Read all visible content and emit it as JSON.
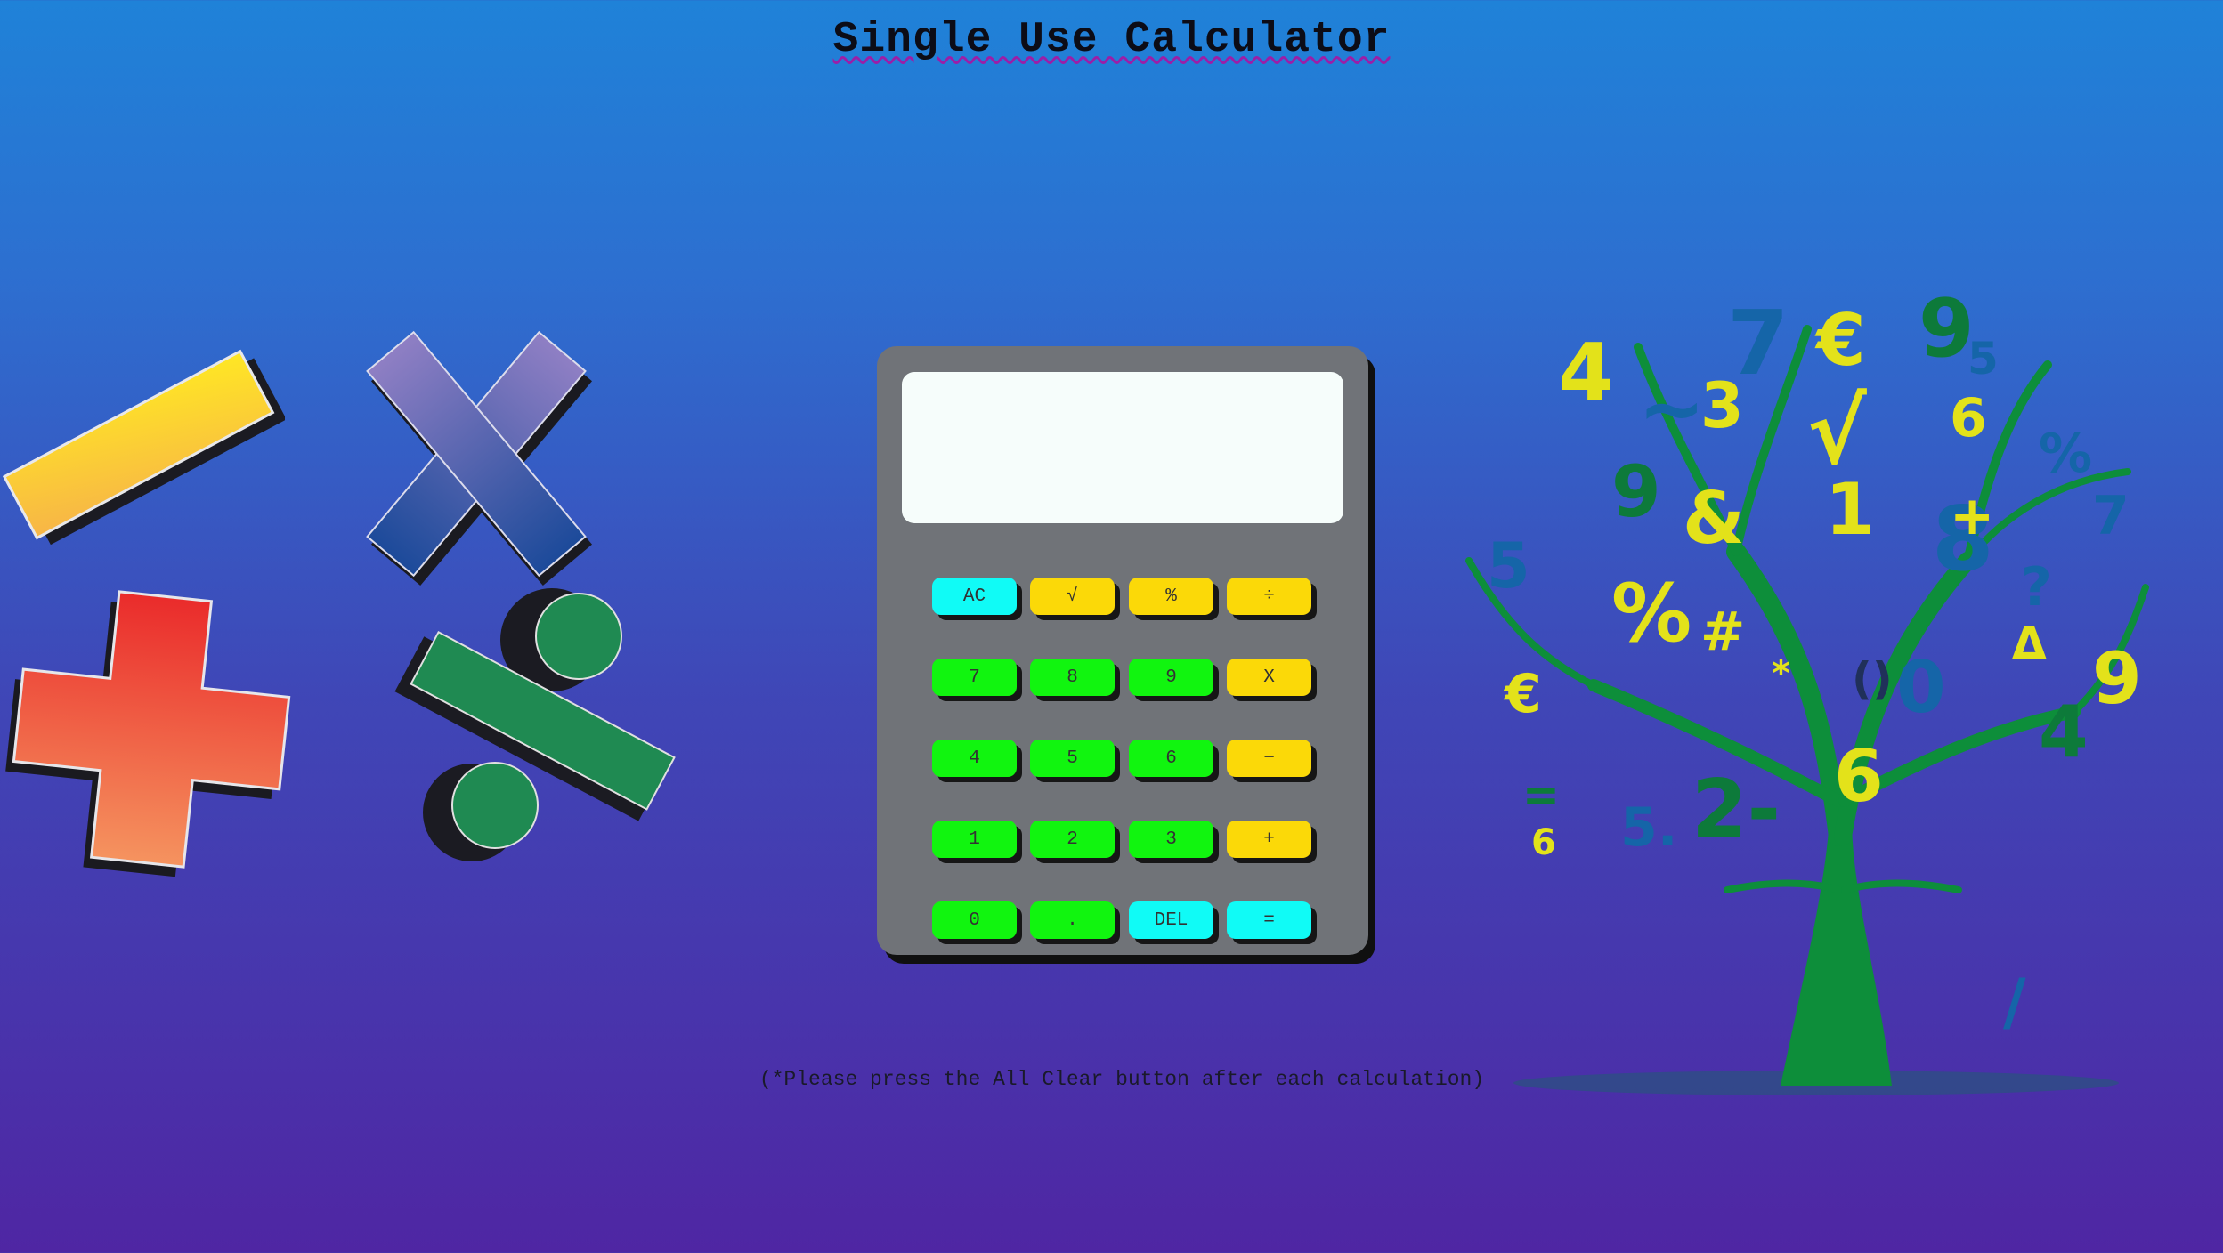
{
  "page": {
    "title": "Single Use Calculator",
    "note": "(*Please press the All Clear button after each calculation)"
  },
  "calculator": {
    "display_value": "",
    "keys": [
      {
        "label": "AC",
        "name": "all-clear-button",
        "color": "#10fbf6"
      },
      {
        "label": "√",
        "name": "square-root-button",
        "color": "#fbd908"
      },
      {
        "label": "%",
        "name": "percent-button",
        "color": "#fbd908"
      },
      {
        "label": "÷",
        "name": "divide-button",
        "color": "#fbd908"
      },
      {
        "label": "7",
        "name": "digit-7-button",
        "color": "#11f50f"
      },
      {
        "label": "8",
        "name": "digit-8-button",
        "color": "#11f50f"
      },
      {
        "label": "9",
        "name": "digit-9-button",
        "color": "#11f50f"
      },
      {
        "label": "X",
        "name": "multiply-button",
        "color": "#fbd908"
      },
      {
        "label": "4",
        "name": "digit-4-button",
        "color": "#11f50f"
      },
      {
        "label": "5",
        "name": "digit-5-button",
        "color": "#11f50f"
      },
      {
        "label": "6",
        "name": "digit-6-button",
        "color": "#11f50f"
      },
      {
        "label": "−",
        "name": "subtract-button",
        "color": "#fbd908"
      },
      {
        "label": "1",
        "name": "digit-1-button",
        "color": "#11f50f"
      },
      {
        "label": "2",
        "name": "digit-2-button",
        "color": "#11f50f"
      },
      {
        "label": "3",
        "name": "digit-3-button",
        "color": "#11f50f"
      },
      {
        "label": "+",
        "name": "add-button",
        "color": "#fbd908"
      },
      {
        "label": "0",
        "name": "digit-0-button",
        "color": "#11f50f"
      },
      {
        "label": ".",
        "name": "decimal-point-button",
        "color": "#11f50f"
      },
      {
        "label": "DEL",
        "name": "delete-button",
        "color": "#10fbf6"
      },
      {
        "label": "=",
        "name": "equals-button",
        "color": "#10fbf6"
      }
    ]
  },
  "decorations": {
    "minus": "minus-sign-icon",
    "times": "multiply-sign-icon",
    "plus": "plus-sign-icon",
    "percent": "percent-sign-icon",
    "tree": "math-symbol-tree-illustration",
    "tree_glyphs": [
      "4",
      "7",
      "€",
      "9",
      "5",
      "~",
      "3",
      "√",
      "6",
      "9",
      "&",
      "1",
      "8",
      "%",
      "#",
      "*",
      "()",
      "0",
      "Δ",
      "9",
      "4",
      "6",
      "=",
      "5.",
      "2-",
      "6",
      "€",
      "7",
      "%",
      "+",
      "?",
      "/",
      "5"
    ]
  },
  "colors": {
    "background_top": "#1f82d8",
    "background_bottom": "#4f26a3",
    "calculator_body": "#707378",
    "display": "#f6fdfb",
    "key_cyan": "#10fbf6",
    "key_yellow": "#fbd908",
    "key_green": "#11f50f",
    "title_underline": "#9a1fa8"
  }
}
